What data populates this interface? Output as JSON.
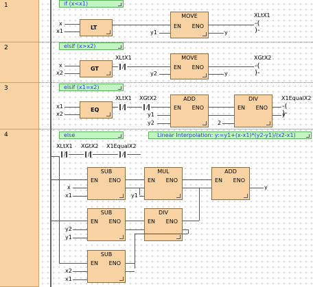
{
  "networks": [
    {
      "number": "1",
      "comment": "if (x<x1)",
      "function_label": "LT",
      "inputs": [
        "x",
        "x1"
      ],
      "move_title": "MOVE",
      "en": "EN",
      "eno": "ENO",
      "move_input": "y1",
      "move_output": "y",
      "coil_label": "XLtX1"
    },
    {
      "number": "2",
      "comment": "elsif (x>x2)",
      "function_label": "GT",
      "inputs": [
        "x",
        "x2"
      ],
      "contact_label": "XLtX1",
      "move_title": "MOVE",
      "en": "EN",
      "eno": "ENO",
      "move_input": "y2",
      "move_output": "y",
      "coil_label": "XGtX2"
    },
    {
      "number": "3",
      "comment": "elsif (x1=x2)",
      "function_label": "EQ",
      "inputs": [
        "x1",
        "x2"
      ],
      "contact_labels": [
        "XLtX1",
        "XGtX2"
      ],
      "add_title": "ADD",
      "div_title": "DIV",
      "en": "EN",
      "eno": "ENO",
      "add_inputs": [
        "y1",
        "y2"
      ],
      "div_input": "2",
      "div_output": "y",
      "coil_label": "X1EqualX2"
    },
    {
      "number": "4",
      "comment": "else",
      "comment2": "Linear Interpolation: y:=y1+(x-x1)*(y2-y1)/(x2-x1)",
      "contact_labels": [
        "XLtX1",
        "XGtX2",
        "X1EqualX2"
      ],
      "sub_title": "SUB",
      "mul_title": "MUL",
      "add_title": "ADD",
      "div_title": "DIV",
      "en": "EN",
      "eno": "ENO",
      "sub1_inputs": [
        "x",
        "x1"
      ],
      "mul_input": "y1",
      "add_output": "y",
      "sub2_inputs": [
        "y2",
        "y1"
      ],
      "sub3_inputs": [
        "x2",
        "x1"
      ]
    }
  ],
  "colors": {
    "background": "#ffffff",
    "block": "#f9d3a4",
    "comment": "#c3f5c3",
    "comment_text": "#1e3fd0"
  }
}
